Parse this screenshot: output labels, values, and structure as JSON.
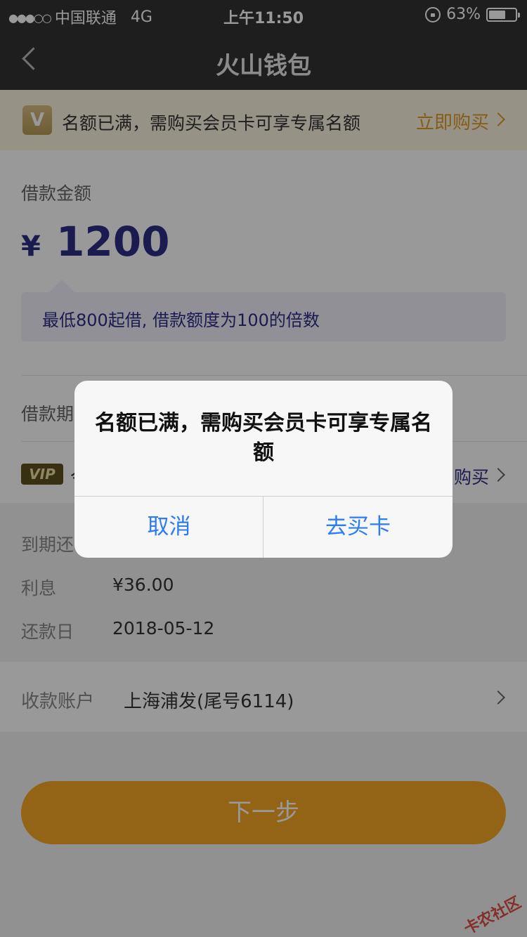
{
  "statusbar": {
    "carrier": "中国联通",
    "network": "4G",
    "time": "上午11:50",
    "battery": "63%",
    "battery_level": 0.63
  },
  "nav": {
    "title": "火山钱包"
  },
  "banner": {
    "badge": "V",
    "text": "名额已满，需购买会员卡可享专属名额",
    "link": "立即购买"
  },
  "loan": {
    "amount_label": "借款金额",
    "currency": "¥",
    "amount": "1200",
    "hint": "最低800起借, 借款额度为100的倍数",
    "period_label": "借款期",
    "vip_badge": "VIP",
    "vip_fragment": "今",
    "vip_link": "购买"
  },
  "repay": {
    "due_label": "到期还",
    "interest_label": "利息",
    "interest_value": "¥36.00",
    "date_label": "还款日",
    "date_value": "2018-05-12"
  },
  "account": {
    "label": "收款账户",
    "value": "上海浦发(尾号6114)"
  },
  "next_button": "下一步",
  "watermark": "卡农社区",
  "dialog": {
    "message": "名额已满，需购买会员卡可享专属名额",
    "cancel": "取消",
    "confirm": "去买卡"
  },
  "colors": {
    "accent": "#2e2e86",
    "button": "#f5a724",
    "link_orange": "#e09a2a",
    "ios_blue": "#2b7cf6"
  }
}
